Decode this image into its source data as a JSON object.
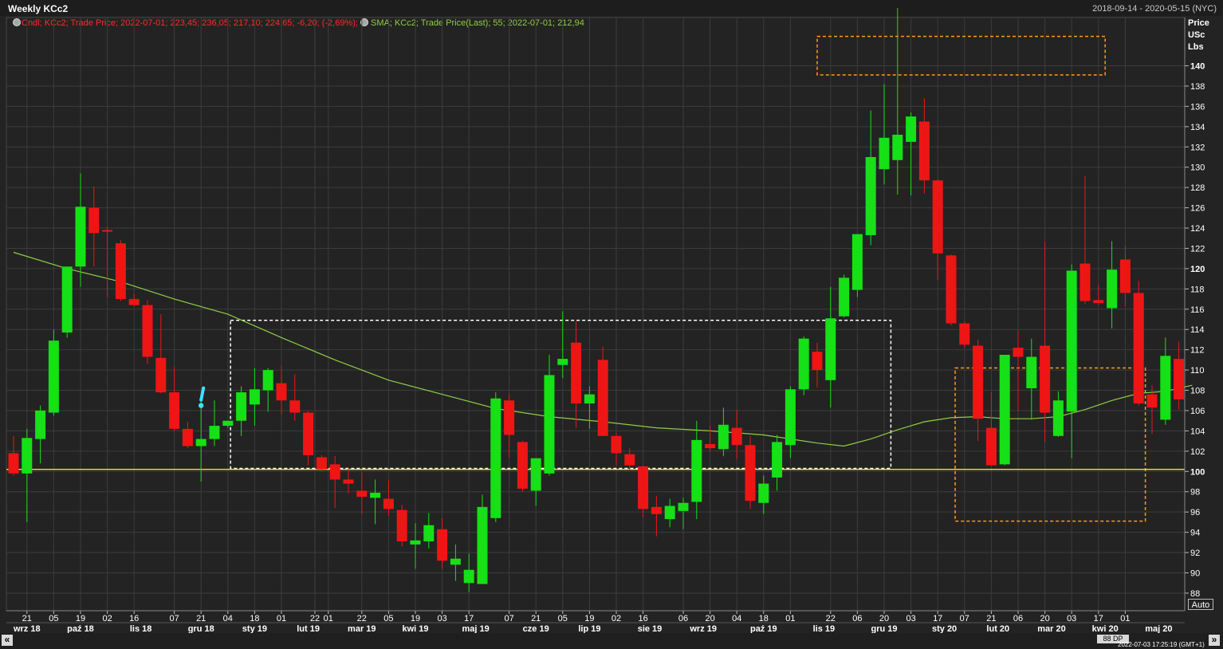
{
  "header": {
    "title": "Weekly KCc2",
    "date_range": "2018-09-14 - 2020-05-15 (NYC)"
  },
  "legend": {
    "candle_text": "Cndl; KCc2; Trade Price; 2022-07-01; 223,45; 236,05; 217,10; 224,65; -6,20; (-2,69%);",
    "sma_text": "SMA; KCc2; Trade Price(Last); 55; 2022-07-01; 212,94"
  },
  "price_axis": {
    "header_lines": [
      "Price",
      "USc",
      "Lbs"
    ],
    "ticks": [
      88,
      90,
      92,
      94,
      96,
      98,
      100,
      102,
      104,
      106,
      108,
      110,
      112,
      114,
      116,
      118,
      120,
      122,
      124,
      126,
      128,
      130,
      132,
      134,
      136,
      138,
      140
    ],
    "bold_ticks": [
      100,
      120,
      140
    ],
    "auto_label": "Auto"
  },
  "footer": {
    "nav_left": "«",
    "nav_right": "»",
    "period_label": "88 DP",
    "timestamp": "2022-07-03 17:25:19 (GMT+1)"
  },
  "chart_data": {
    "type": "candlestick",
    "title": "Weekly KCc2",
    "ylim": [
      87,
      147
    ],
    "candles": [
      {
        "o": 101.8,
        "h": 103.5,
        "l": 99.6,
        "c": 99.8
      },
      {
        "o": 99.8,
        "h": 104.2,
        "l": 95,
        "c": 103.3
      },
      {
        "o": 103.2,
        "h": 106.5,
        "l": 100.8,
        "c": 106
      },
      {
        "o": 105.8,
        "h": 114,
        "l": 105.5,
        "c": 112.9
      },
      {
        "o": 113.7,
        "h": 120.2,
        "l": 113.2,
        "c": 120.2
      },
      {
        "o": 120.2,
        "h": 129.4,
        "l": 118.2,
        "c": 126.1
      },
      {
        "o": 126,
        "h": 128.1,
        "l": 120.2,
        "c": 123.5
      },
      {
        "o": 123.8,
        "h": 124.1,
        "l": 117.2,
        "c": 123.7
      },
      {
        "o": 122.5,
        "h": 122.8,
        "l": 116.8,
        "c": 117
      },
      {
        "o": 117,
        "h": 117.5,
        "l": 116.3,
        "c": 116.4
      },
      {
        "o": 116.4,
        "h": 116.9,
        "l": 110.6,
        "c": 111.3
      },
      {
        "o": 111.2,
        "h": 115.5,
        "l": 107.7,
        "c": 107.8
      },
      {
        "o": 107.8,
        "h": 110.3,
        "l": 104,
        "c": 104.2
      },
      {
        "o": 104.2,
        "h": 104.9,
        "l": 102.3,
        "c": 102.5
      },
      {
        "o": 102.5,
        "h": 107.3,
        "l": 99,
        "c": 103.2
      },
      {
        "o": 103.2,
        "h": 107,
        "l": 102.5,
        "c": 104.5
      },
      {
        "o": 104.5,
        "h": 104.8,
        "l": 104.3,
        "c": 105
      },
      {
        "o": 105,
        "h": 108.4,
        "l": 103.5,
        "c": 107.8
      },
      {
        "o": 106.6,
        "h": 110.2,
        "l": 104.5,
        "c": 108.1
      },
      {
        "o": 108,
        "h": 110.2,
        "l": 105.9,
        "c": 110
      },
      {
        "o": 108.7,
        "h": 110.4,
        "l": 105.6,
        "c": 107
      },
      {
        "o": 107,
        "h": 109.6,
        "l": 105,
        "c": 105.8
      },
      {
        "o": 105.8,
        "h": 106,
        "l": 100.6,
        "c": 101.6
      },
      {
        "o": 101.4,
        "h": 101.6,
        "l": 100,
        "c": 100.2
      },
      {
        "o": 100.7,
        "h": 101.5,
        "l": 96.4,
        "c": 99.2
      },
      {
        "o": 99.2,
        "h": 100.3,
        "l": 97.8,
        "c": 98.8
      },
      {
        "o": 98.1,
        "h": 99.9,
        "l": 95.8,
        "c": 97.5
      },
      {
        "o": 97.4,
        "h": 99.2,
        "l": 94.8,
        "c": 97.9
      },
      {
        "o": 97.3,
        "h": 99.1,
        "l": 95.6,
        "c": 96.3
      },
      {
        "o": 96.2,
        "h": 96.7,
        "l": 92.6,
        "c": 93.1
      },
      {
        "o": 92.8,
        "h": 94.9,
        "l": 90.4,
        "c": 93.2
      },
      {
        "o": 93.1,
        "h": 95.9,
        "l": 92.4,
        "c": 94.7
      },
      {
        "o": 94.3,
        "h": 95.4,
        "l": 90.4,
        "c": 91.2
      },
      {
        "o": 90.8,
        "h": 92.8,
        "l": 89.2,
        "c": 91.4
      },
      {
        "o": 89,
        "h": 91.9,
        "l": 88.1,
        "c": 90.3
      },
      {
        "o": 88.9,
        "h": 97.7,
        "l": 88.9,
        "c": 96.5
      },
      {
        "o": 95.4,
        "h": 107.8,
        "l": 95,
        "c": 107.2
      },
      {
        "o": 107,
        "h": 107.7,
        "l": 101.4,
        "c": 103.6
      },
      {
        "o": 102.9,
        "h": 103,
        "l": 98,
        "c": 98.3
      },
      {
        "o": 98.1,
        "h": 101.1,
        "l": 96.6,
        "c": 101.3
      },
      {
        "o": 99.8,
        "h": 111.5,
        "l": 99.6,
        "c": 109.5
      },
      {
        "o": 110.5,
        "h": 115.8,
        "l": 109.2,
        "c": 111.1
      },
      {
        "o": 112.7,
        "h": 114.8,
        "l": 104.3,
        "c": 106.7
      },
      {
        "o": 106.7,
        "h": 108.4,
        "l": 104.2,
        "c": 107.6
      },
      {
        "o": 111,
        "h": 112.3,
        "l": 103.5,
        "c": 103.5
      },
      {
        "o": 103.5,
        "h": 103.8,
        "l": 100.6,
        "c": 101.8
      },
      {
        "o": 101.7,
        "h": 102.3,
        "l": 100.1,
        "c": 100.6
      },
      {
        "o": 100.5,
        "h": 100.6,
        "l": 95.5,
        "c": 96.3
      },
      {
        "o": 96.5,
        "h": 97.6,
        "l": 93.6,
        "c": 95.8
      },
      {
        "o": 95.3,
        "h": 97.3,
        "l": 94.5,
        "c": 96.6
      },
      {
        "o": 96.1,
        "h": 97.4,
        "l": 94.3,
        "c": 96.9
      },
      {
        "o": 97,
        "h": 105,
        "l": 95.3,
        "c": 103.1
      },
      {
        "o": 102.7,
        "h": 104.5,
        "l": 102,
        "c": 102.3
      },
      {
        "o": 102.2,
        "h": 106.3,
        "l": 101.5,
        "c": 104.6
      },
      {
        "o": 104.3,
        "h": 106.1,
        "l": 101.2,
        "c": 102.6
      },
      {
        "o": 102.6,
        "h": 103.5,
        "l": 96.3,
        "c": 97.1
      },
      {
        "o": 96.9,
        "h": 99.6,
        "l": 95.8,
        "c": 98.8
      },
      {
        "o": 99.4,
        "h": 103.6,
        "l": 98.1,
        "c": 102.9
      },
      {
        "o": 102.6,
        "h": 108.4,
        "l": 101.3,
        "c": 108.1
      },
      {
        "o": 108.1,
        "h": 113.3,
        "l": 107.5,
        "c": 113.1
      },
      {
        "o": 111.8,
        "h": 112.7,
        "l": 108.3,
        "c": 110
      },
      {
        "o": 109,
        "h": 118.2,
        "l": 106.3,
        "c": 115.1
      },
      {
        "o": 115.3,
        "h": 119.4,
        "l": 115.2,
        "c": 119.1
      },
      {
        "o": 117.9,
        "h": 123.4,
        "l": 117.2,
        "c": 123.4
      },
      {
        "o": 123.3,
        "h": 135.6,
        "l": 122.3,
        "c": 131
      },
      {
        "o": 129.8,
        "h": 138.2,
        "l": 128.3,
        "c": 132.9
      },
      {
        "o": 130.7,
        "h": 145.7,
        "l": 127.3,
        "c": 133.2
      },
      {
        "o": 132.5,
        "h": 135.4,
        "l": 127.2,
        "c": 135
      },
      {
        "o": 134.5,
        "h": 136.8,
        "l": 127.4,
        "c": 128.7
      },
      {
        "o": 128.7,
        "h": 128.8,
        "l": 118.9,
        "c": 121.5
      },
      {
        "o": 121.3,
        "h": 121.4,
        "l": 114.4,
        "c": 114.6
      },
      {
        "o": 114.6,
        "h": 114.8,
        "l": 112.2,
        "c": 112.5
      },
      {
        "o": 112.4,
        "h": 113,
        "l": 103,
        "c": 105.2
      },
      {
        "o": 104.3,
        "h": 107.8,
        "l": 100.6,
        "c": 100.6
      },
      {
        "o": 100.7,
        "h": 111.5,
        "l": 100.6,
        "c": 111.5
      },
      {
        "o": 112.2,
        "h": 113.9,
        "l": 106,
        "c": 111.3
      },
      {
        "o": 108.2,
        "h": 113.1,
        "l": 105.1,
        "c": 111.3
      },
      {
        "o": 112.4,
        "h": 122.6,
        "l": 102.9,
        "c": 105.8
      },
      {
        "o": 103.5,
        "h": 107.9,
        "l": 103.4,
        "c": 107
      },
      {
        "o": 105.9,
        "h": 120.4,
        "l": 101.3,
        "c": 119.8
      },
      {
        "o": 120.5,
        "h": 129.1,
        "l": 116.5,
        "c": 116.8
      },
      {
        "o": 116.9,
        "h": 118.4,
        "l": 116.4,
        "c": 116.6
      },
      {
        "o": 116.1,
        "h": 122.7,
        "l": 114.1,
        "c": 119.9
      },
      {
        "o": 120.9,
        "h": 122.3,
        "l": 116.3,
        "c": 117.6
      },
      {
        "o": 117.6,
        "h": 118.8,
        "l": 106.5,
        "c": 106.7
      },
      {
        "o": 107.6,
        "h": 108.5,
        "l": 103.7,
        "c": 106.3
      },
      {
        "o": 105.1,
        "h": 113.2,
        "l": 104.6,
        "c": 111.4
      },
      {
        "o": 111.1,
        "h": 112.8,
        "l": 106.1,
        "c": 107.1
      }
    ],
    "sma": {
      "name": "SMA 55",
      "points": [
        [
          0,
          121.6
        ],
        [
          4,
          120
        ],
        [
          8,
          118.7
        ],
        [
          12,
          117
        ],
        [
          16,
          115.5
        ],
        [
          20,
          113.2
        ],
        [
          24,
          111
        ],
        [
          28,
          109
        ],
        [
          32,
          107.6
        ],
        [
          36,
          106.2
        ],
        [
          40,
          105.4
        ],
        [
          44,
          104.9
        ],
        [
          48,
          104.3
        ],
        [
          52,
          104
        ],
        [
          56,
          103.6
        ],
        [
          60,
          102.8
        ],
        [
          62,
          102.5
        ],
        [
          64,
          103.2
        ],
        [
          66,
          104.1
        ],
        [
          68,
          104.9
        ],
        [
          70,
          105.3
        ],
        [
          72,
          105.4
        ],
        [
          74,
          105.2
        ],
        [
          76,
          105.2
        ],
        [
          78,
          105.4
        ],
        [
          80,
          106.1
        ],
        [
          82,
          107
        ],
        [
          84,
          107.7
        ],
        [
          86,
          107.9
        ],
        [
          88,
          108.5
        ]
      ]
    },
    "horizontal_lines": [
      {
        "value": 100.2,
        "color": "#ffff33"
      }
    ],
    "annotation_boxes": [
      {
        "x0": 16.2,
        "x1": 65.5,
        "y0": 100.3,
        "y1": 114.9,
        "color": "#ffffff"
      },
      {
        "x0": 60,
        "x1": 81.5,
        "y0": 139.1,
        "y1": 142.9,
        "color": "#ff9a1a"
      },
      {
        "x0": 70.3,
        "x1": 84.5,
        "y0": 95.1,
        "y1": 110.2,
        "color": "#ff9a1a"
      }
    ],
    "marker": {
      "index": 14,
      "value": 106.5,
      "symbol": "!",
      "color": "#40e0ff"
    },
    "x_ticks": [
      {
        "i": 1,
        "label": "21"
      },
      {
        "i": 3,
        "label": "05"
      },
      {
        "i": 5,
        "label": "19"
      },
      {
        "i": 7,
        "label": "02"
      },
      {
        "i": 9,
        "label": "16"
      },
      {
        "i": 12,
        "label": "07"
      },
      {
        "i": 14,
        "label": "21"
      },
      {
        "i": 16,
        "label": "04"
      },
      {
        "i": 18,
        "label": "18"
      },
      {
        "i": 20,
        "label": "01"
      },
      {
        "i": 22.5,
        "label": "22"
      },
      {
        "i": 23.5,
        "label": "01"
      },
      {
        "i": 26,
        "label": "22"
      },
      {
        "i": 28,
        "label": "05"
      },
      {
        "i": 30,
        "label": "19"
      },
      {
        "i": 32,
        "label": "03"
      },
      {
        "i": 34,
        "label": "17"
      },
      {
        "i": 37,
        "label": "07"
      },
      {
        "i": 39,
        "label": "21"
      },
      {
        "i": 41,
        "label": "05"
      },
      {
        "i": 43,
        "label": "19"
      },
      {
        "i": 45,
        "label": "02"
      },
      {
        "i": 47,
        "label": "16"
      },
      {
        "i": 50,
        "label": "06"
      },
      {
        "i": 52,
        "label": "20"
      },
      {
        "i": 54,
        "label": "04"
      },
      {
        "i": 56,
        "label": "18"
      },
      {
        "i": 58,
        "label": "01"
      },
      {
        "i": 61,
        "label": "22"
      },
      {
        "i": 63,
        "label": "06"
      },
      {
        "i": 65,
        "label": "20"
      },
      {
        "i": 67,
        "label": "03"
      },
      {
        "i": 69,
        "label": "17"
      },
      {
        "i": 71,
        "label": "07"
      },
      {
        "i": 73,
        "label": "21"
      },
      {
        "i": 75,
        "label": "06"
      },
      {
        "i": 77,
        "label": "20"
      },
      {
        "i": 79,
        "label": "03"
      },
      {
        "i": 81,
        "label": "17"
      },
      {
        "i": 83,
        "label": "01"
      }
    ],
    "month_labels": [
      {
        "i": 1,
        "label": "wrz 18"
      },
      {
        "i": 5,
        "label": "paź 18"
      },
      {
        "i": 9.5,
        "label": "lis 18"
      },
      {
        "i": 14,
        "label": "gru 18"
      },
      {
        "i": 18,
        "label": "sty 19"
      },
      {
        "i": 22,
        "label": "lut 19"
      },
      {
        "i": 26,
        "label": "mar 19"
      },
      {
        "i": 30,
        "label": "kwi 19"
      },
      {
        "i": 34.5,
        "label": "maj 19"
      },
      {
        "i": 39,
        "label": "cze 19"
      },
      {
        "i": 43,
        "label": "lip 19"
      },
      {
        "i": 47.5,
        "label": "sie 19"
      },
      {
        "i": 51.5,
        "label": "wrz 19"
      },
      {
        "i": 56,
        "label": "paź 19"
      },
      {
        "i": 60.5,
        "label": "lis 19"
      },
      {
        "i": 65,
        "label": "gru 19"
      },
      {
        "i": 69.5,
        "label": "sty 20"
      },
      {
        "i": 73.5,
        "label": "lut 20"
      },
      {
        "i": 77.5,
        "label": "mar 20"
      },
      {
        "i": 81.5,
        "label": "kwi 20"
      },
      {
        "i": 85.5,
        "label": "maj 20"
      }
    ],
    "colors": {
      "up": "#16e016",
      "down": "#ee1515",
      "sma": "#8dcf43",
      "grid": "#3c3c3c",
      "background": "#232323"
    }
  }
}
